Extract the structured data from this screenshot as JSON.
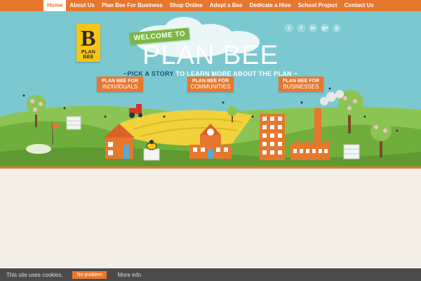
{
  "nav": {
    "items": [
      {
        "label": "Home",
        "active": true
      },
      {
        "label": "About Us"
      },
      {
        "label": "Plan Bee For Business"
      },
      {
        "label": "Shop Online"
      },
      {
        "label": "Adopt a Bee"
      },
      {
        "label": "Dedicate a Hive"
      },
      {
        "label": "School Project"
      },
      {
        "label": "Contact Us"
      }
    ]
  },
  "logo": {
    "letter": "B",
    "text": "PLAN BEE"
  },
  "social": {
    "twitter": "t",
    "facebook": "f",
    "linkedin": "in",
    "googleplus": "g+",
    "pinterest": "p"
  },
  "hero": {
    "welcome": "WELCOME TO",
    "title": "PLAN BEE",
    "tagline_lead": "~PICK A STORY",
    "tagline_rest": " TO LEARN MORE ABOUT THE PLAN ~",
    "signs": [
      {
        "line1": "PLAN BEE FOR",
        "line2": "INDIVIDUALS"
      },
      {
        "line1": "PLAN BEE FOR",
        "line2": "COMMUNITIES"
      },
      {
        "line1": "PLAN BEE FOR",
        "line2": "BUSINESSES"
      }
    ]
  },
  "cookie": {
    "message": "This site uses cookies.",
    "button": "No problem",
    "link": "More info"
  },
  "colors": {
    "nav": "#e8772e",
    "sky": "#7cc8d0",
    "hill": "#7bb843",
    "field": "#f0d23a",
    "building": "#e8772e",
    "page": "#f3efe6",
    "footer": "#4b4b4b"
  }
}
